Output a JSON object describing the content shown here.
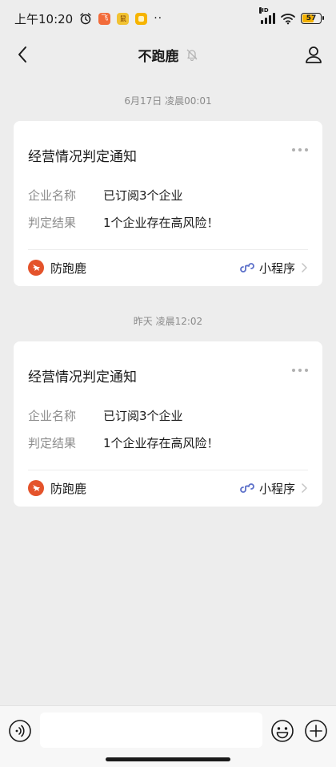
{
  "status_bar": {
    "time": "上午10:20",
    "app_icon_1": "飞",
    "app_icon_2": "鼠",
    "dots": "··",
    "network_label": "HD",
    "battery": "57",
    "battery_level": 0.57,
    "icons": [
      "alarm-icon",
      "app-notification-icon",
      "app-notification-icon",
      "app-notification-icon",
      "signal-icon",
      "wifi-icon",
      "battery-icon"
    ]
  },
  "nav": {
    "title": "不跑鹿",
    "icons": [
      "back-icon",
      "bell-muted-icon",
      "profile-icon"
    ]
  },
  "messages": [
    {
      "timestamp": "6月17日 凌晨00:01",
      "title": "经营情况判定通知",
      "fields": [
        {
          "label": "企业名称",
          "value": "已订阅3个企业"
        },
        {
          "label": "判定结果",
          "value": "1个企业存在高风险！"
        }
      ],
      "app_name": "防跑鹿",
      "mini_program_label": "小程序"
    },
    {
      "timestamp": "昨天 凌晨12:02",
      "title": "经营情况判定通知",
      "fields": [
        {
          "label": "企业名称",
          "value": "已订阅3个企业"
        },
        {
          "label": "判定结果",
          "value": "1个企业存在高风险！"
        }
      ],
      "app_name": "防跑鹿",
      "mini_program_label": "小程序"
    }
  ],
  "input_bar": {
    "placeholder": "",
    "value": "",
    "icons": [
      "voice-icon",
      "emoji-icon",
      "plus-icon"
    ]
  },
  "colors": {
    "background": "#ededed",
    "card": "#ffffff",
    "app_logo": "#e4532b",
    "mini_program_link": "#5b6fc9",
    "battery_fill": "#f2b000"
  }
}
